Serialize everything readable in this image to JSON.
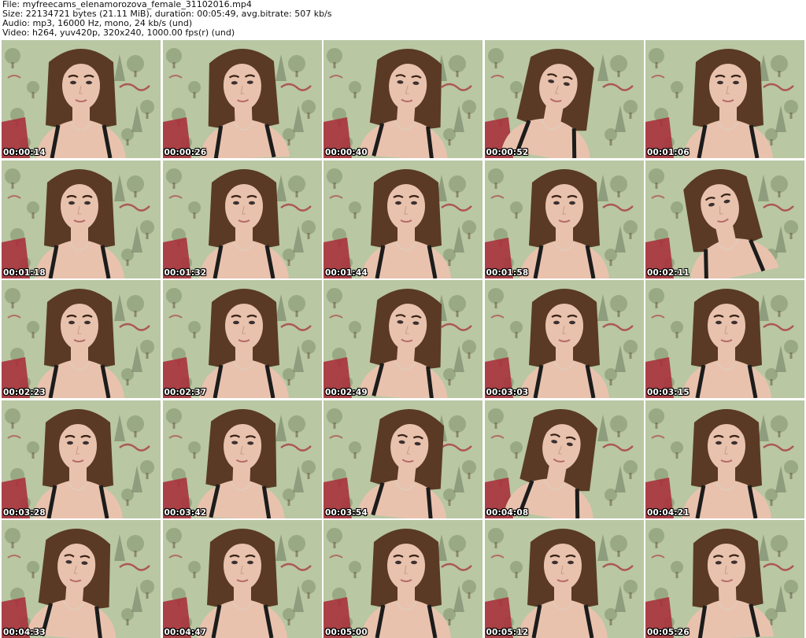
{
  "header": {
    "file_line": "File: myfreecams_elenamorozova_female_31102016.mp4",
    "size_line": "Size: 22134721 bytes (21.11 MiB), duration: 00:05:49, avg.bitrate: 507 kb/s",
    "audio_line": "Audio: mp3, 16000 Hz, mono, 24 kb/s (und)",
    "video_line": "Video: h264, yuv420p, 320x240, 1000.00 fps(r) (und)"
  },
  "colors": {
    "wallpaper": "#b9c7a3",
    "wallpaper_dark": "#7d8f6c",
    "accent_red": "#a8323c",
    "hair": "#5a3a24",
    "skin": "#e9c2ae",
    "strap": "#1c1c1c"
  },
  "thumbnails": [
    {
      "timestamp": "00:00:14"
    },
    {
      "timestamp": "00:00:26"
    },
    {
      "timestamp": "00:00:40"
    },
    {
      "timestamp": "00:00:52"
    },
    {
      "timestamp": "00:01:06"
    },
    {
      "timestamp": "00:01:18"
    },
    {
      "timestamp": "00:01:32"
    },
    {
      "timestamp": "00:01:44"
    },
    {
      "timestamp": "00:01:58"
    },
    {
      "timestamp": "00:02:11"
    },
    {
      "timestamp": "00:02:23"
    },
    {
      "timestamp": "00:02:37"
    },
    {
      "timestamp": "00:02:49"
    },
    {
      "timestamp": "00:03:03"
    },
    {
      "timestamp": "00:03:15"
    },
    {
      "timestamp": "00:03:28"
    },
    {
      "timestamp": "00:03:42"
    },
    {
      "timestamp": "00:03:54"
    },
    {
      "timestamp": "00:04:08"
    },
    {
      "timestamp": "00:04:21"
    },
    {
      "timestamp": "00:04:33"
    },
    {
      "timestamp": "00:04:47"
    },
    {
      "timestamp": "00:05:00"
    },
    {
      "timestamp": "00:05:12"
    },
    {
      "timestamp": "00:05:26"
    }
  ]
}
